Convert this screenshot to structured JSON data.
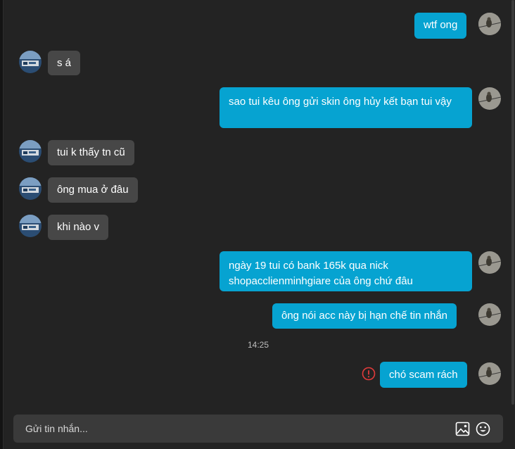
{
  "conversation": {
    "messages": [
      {
        "side": "out",
        "text": "wtf ong"
      },
      {
        "side": "in",
        "text": "s á"
      },
      {
        "side": "out",
        "text": "sao tui kêu ông gửi skin ông hủy kết bạn tui vậy"
      },
      {
        "side": "in",
        "text": "tui k thấy tn cũ"
      },
      {
        "side": "in",
        "text": "ông mua ở đâu"
      },
      {
        "side": "in",
        "text": "khi nào v"
      },
      {
        "side": "out",
        "text": "ngày 19 tui có bank 165k qua nick shopacclienminhgiare của ông chứ đâu"
      },
      {
        "side": "out",
        "text": "ông nói acc này bị hạn chế tin nhắn"
      },
      {
        "side": "out",
        "text": "chó scam rách",
        "status": "error"
      }
    ],
    "timestamp": "14:25"
  },
  "composer": {
    "placeholder": "Gửi tin nhắn...",
    "value": "",
    "icons": [
      "image-icon",
      "emoji-icon"
    ]
  },
  "colors": {
    "outgoing": "#06a3d1",
    "incoming": "#474747",
    "background": "#232323",
    "error": "#e23b3b"
  }
}
